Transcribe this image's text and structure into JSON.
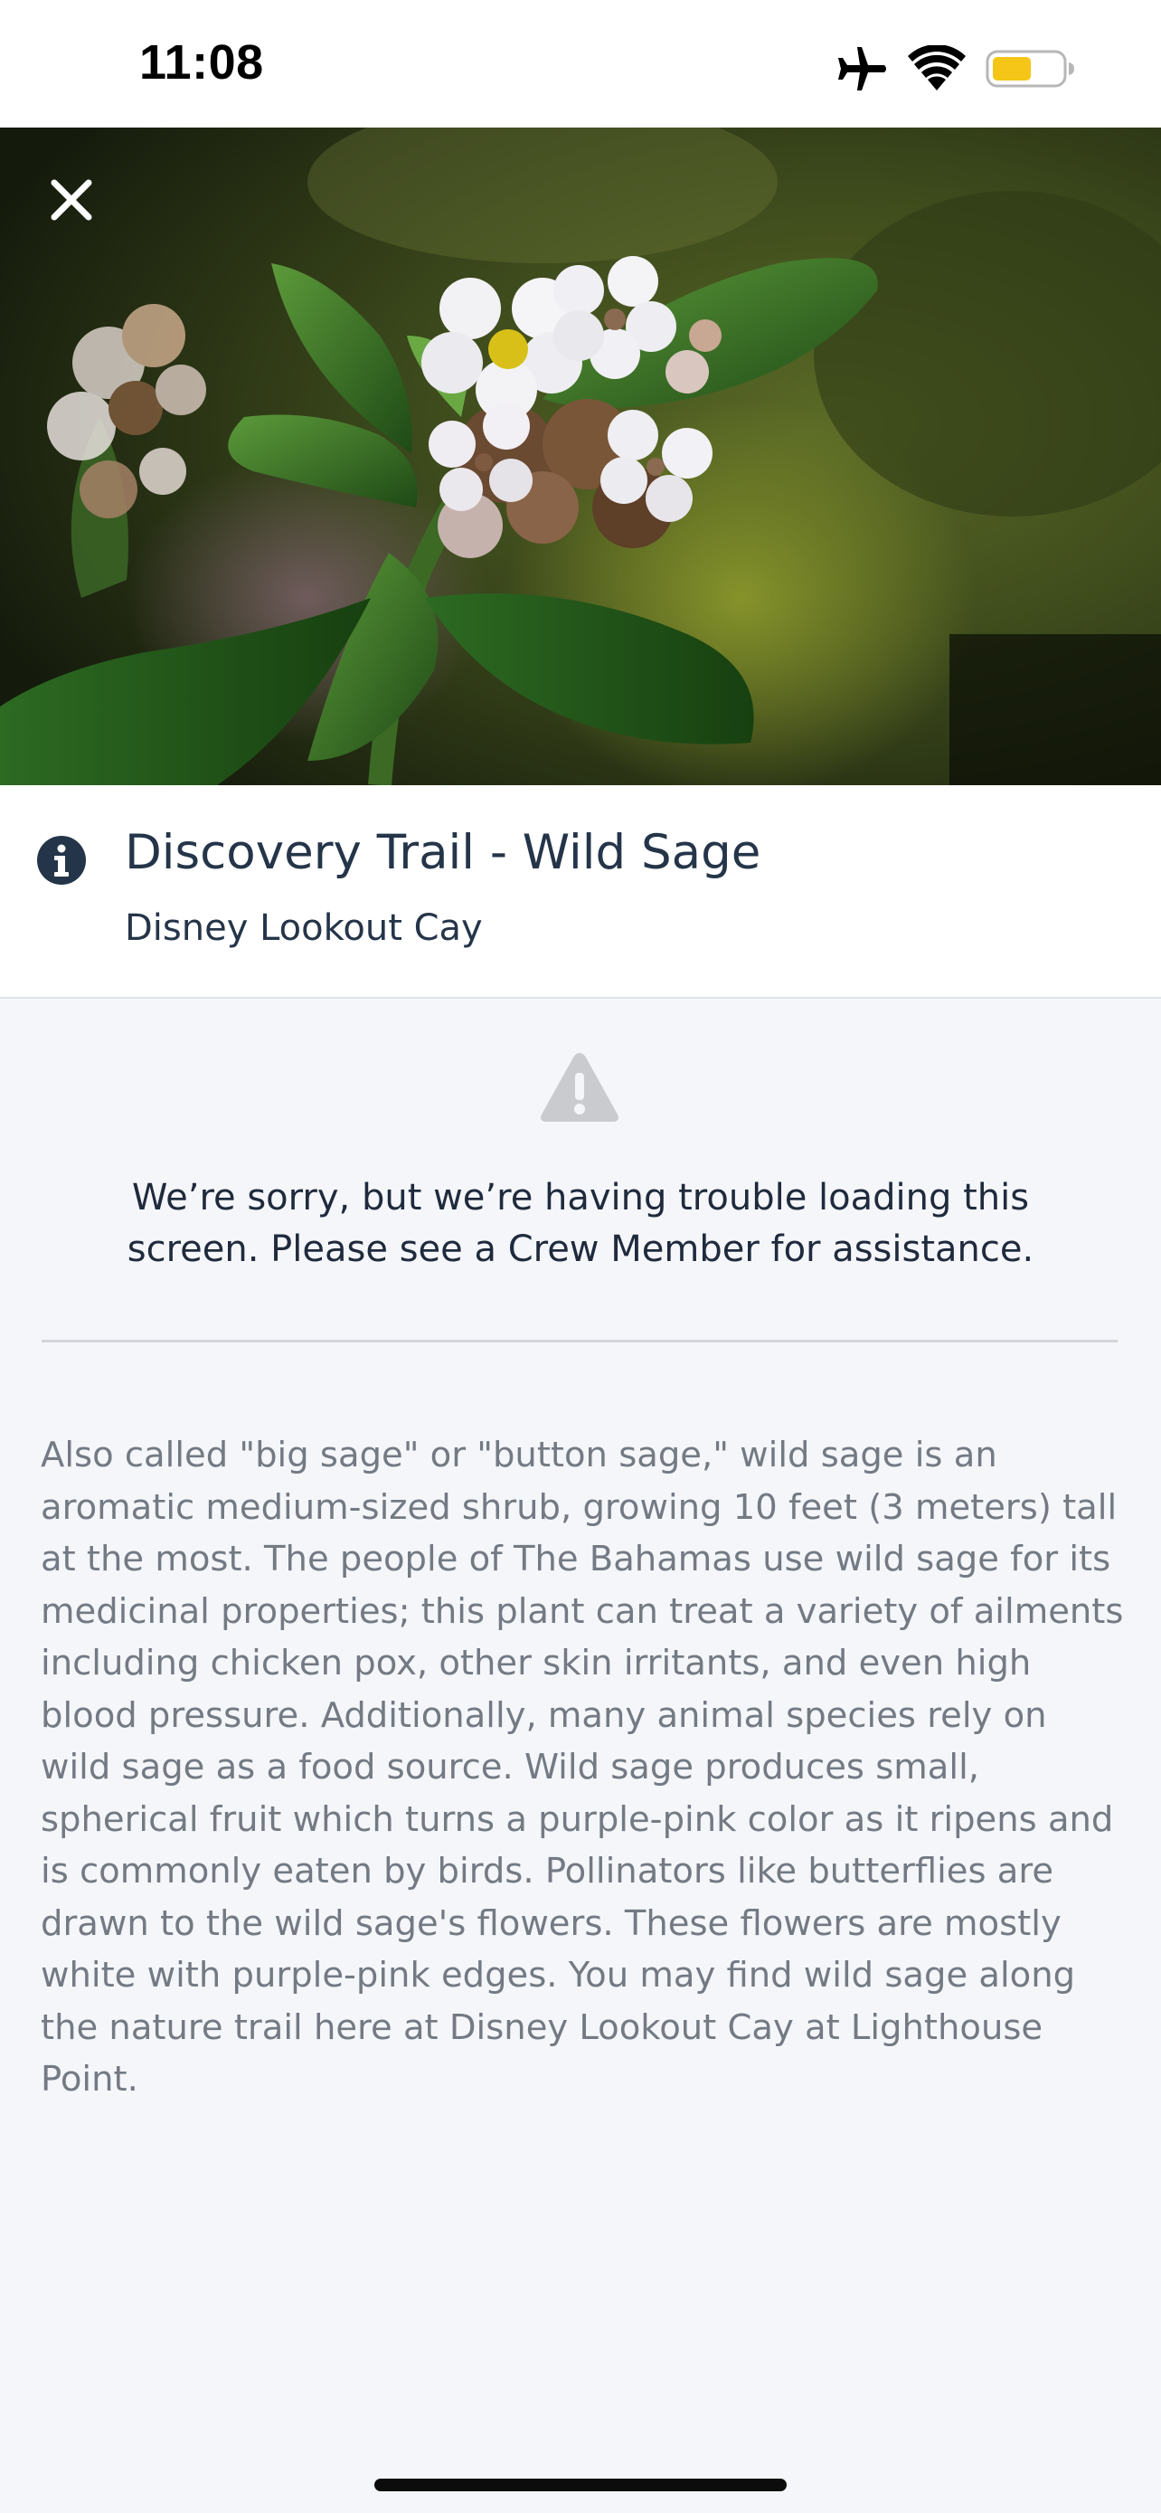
{
  "status_bar": {
    "time": "11:08",
    "icons": [
      "airplane-icon",
      "wifi-icon",
      "battery-icon"
    ],
    "battery_color": "#f5c518"
  },
  "hero": {
    "image": "flower-photo",
    "close_icon": "close-icon"
  },
  "header": {
    "icon": "info-icon",
    "title": "Discovery Trail - Wild Sage",
    "subtitle": "Disney Lookout Cay"
  },
  "error": {
    "icon": "warning-icon",
    "message": "We’re sorry, but we’re having trouble loading this screen. Please see a Crew Member for assistance."
  },
  "description": "Also called \"big sage\" or \"button sage,\" wild sage is an aromatic medium-sized shrub, growing 10 feet (3 meters) tall at the most. The people of The Bahamas use wild sage for its medicinal properties; this plant can treat a variety of ailments including chicken pox, other skin irritants, and even high blood pressure. Additionally, many animal species rely on wild sage as a food source. Wild sage produces small, spherical fruit which turns a purple-pink color as it ripens and is commonly eaten by birds. Pollinators like butterflies are drawn to the wild sage's flowers. These flowers are mostly white with purple-pink edges. You may find wild sage along the nature trail here at Disney Lookout Cay at Lighthouse Point.",
  "colors": {
    "title_text": "#253549",
    "body_text": "#737a84",
    "background": "#f5f6f9"
  }
}
